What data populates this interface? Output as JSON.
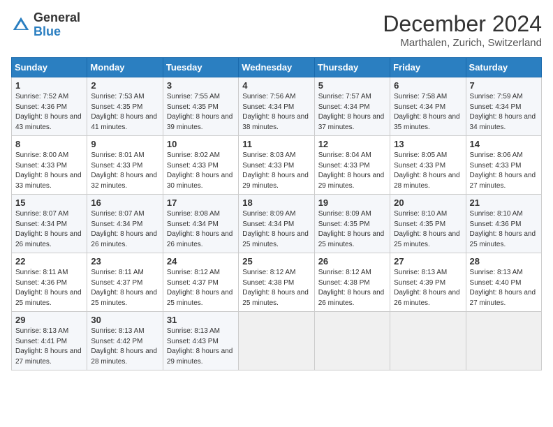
{
  "logo": {
    "general": "General",
    "blue": "Blue"
  },
  "title": "December 2024",
  "location": "Marthalen, Zurich, Switzerland",
  "headers": [
    "Sunday",
    "Monday",
    "Tuesday",
    "Wednesday",
    "Thursday",
    "Friday",
    "Saturday"
  ],
  "weeks": [
    [
      {
        "day": "1",
        "sunrise": "Sunrise: 7:52 AM",
        "sunset": "Sunset: 4:36 PM",
        "daylight": "Daylight: 8 hours and 43 minutes."
      },
      {
        "day": "2",
        "sunrise": "Sunrise: 7:53 AM",
        "sunset": "Sunset: 4:35 PM",
        "daylight": "Daylight: 8 hours and 41 minutes."
      },
      {
        "day": "3",
        "sunrise": "Sunrise: 7:55 AM",
        "sunset": "Sunset: 4:35 PM",
        "daylight": "Daylight: 8 hours and 39 minutes."
      },
      {
        "day": "4",
        "sunrise": "Sunrise: 7:56 AM",
        "sunset": "Sunset: 4:34 PM",
        "daylight": "Daylight: 8 hours and 38 minutes."
      },
      {
        "day": "5",
        "sunrise": "Sunrise: 7:57 AM",
        "sunset": "Sunset: 4:34 PM",
        "daylight": "Daylight: 8 hours and 37 minutes."
      },
      {
        "day": "6",
        "sunrise": "Sunrise: 7:58 AM",
        "sunset": "Sunset: 4:34 PM",
        "daylight": "Daylight: 8 hours and 35 minutes."
      },
      {
        "day": "7",
        "sunrise": "Sunrise: 7:59 AM",
        "sunset": "Sunset: 4:34 PM",
        "daylight": "Daylight: 8 hours and 34 minutes."
      }
    ],
    [
      {
        "day": "8",
        "sunrise": "Sunrise: 8:00 AM",
        "sunset": "Sunset: 4:33 PM",
        "daylight": "Daylight: 8 hours and 33 minutes."
      },
      {
        "day": "9",
        "sunrise": "Sunrise: 8:01 AM",
        "sunset": "Sunset: 4:33 PM",
        "daylight": "Daylight: 8 hours and 32 minutes."
      },
      {
        "day": "10",
        "sunrise": "Sunrise: 8:02 AM",
        "sunset": "Sunset: 4:33 PM",
        "daylight": "Daylight: 8 hours and 30 minutes."
      },
      {
        "day": "11",
        "sunrise": "Sunrise: 8:03 AM",
        "sunset": "Sunset: 4:33 PM",
        "daylight": "Daylight: 8 hours and 29 minutes."
      },
      {
        "day": "12",
        "sunrise": "Sunrise: 8:04 AM",
        "sunset": "Sunset: 4:33 PM",
        "daylight": "Daylight: 8 hours and 29 minutes."
      },
      {
        "day": "13",
        "sunrise": "Sunrise: 8:05 AM",
        "sunset": "Sunset: 4:33 PM",
        "daylight": "Daylight: 8 hours and 28 minutes."
      },
      {
        "day": "14",
        "sunrise": "Sunrise: 8:06 AM",
        "sunset": "Sunset: 4:33 PM",
        "daylight": "Daylight: 8 hours and 27 minutes."
      }
    ],
    [
      {
        "day": "15",
        "sunrise": "Sunrise: 8:07 AM",
        "sunset": "Sunset: 4:34 PM",
        "daylight": "Daylight: 8 hours and 26 minutes."
      },
      {
        "day": "16",
        "sunrise": "Sunrise: 8:07 AM",
        "sunset": "Sunset: 4:34 PM",
        "daylight": "Daylight: 8 hours and 26 minutes."
      },
      {
        "day": "17",
        "sunrise": "Sunrise: 8:08 AM",
        "sunset": "Sunset: 4:34 PM",
        "daylight": "Daylight: 8 hours and 26 minutes."
      },
      {
        "day": "18",
        "sunrise": "Sunrise: 8:09 AM",
        "sunset": "Sunset: 4:34 PM",
        "daylight": "Daylight: 8 hours and 25 minutes."
      },
      {
        "day": "19",
        "sunrise": "Sunrise: 8:09 AM",
        "sunset": "Sunset: 4:35 PM",
        "daylight": "Daylight: 8 hours and 25 minutes."
      },
      {
        "day": "20",
        "sunrise": "Sunrise: 8:10 AM",
        "sunset": "Sunset: 4:35 PM",
        "daylight": "Daylight: 8 hours and 25 minutes."
      },
      {
        "day": "21",
        "sunrise": "Sunrise: 8:10 AM",
        "sunset": "Sunset: 4:36 PM",
        "daylight": "Daylight: 8 hours and 25 minutes."
      }
    ],
    [
      {
        "day": "22",
        "sunrise": "Sunrise: 8:11 AM",
        "sunset": "Sunset: 4:36 PM",
        "daylight": "Daylight: 8 hours and 25 minutes."
      },
      {
        "day": "23",
        "sunrise": "Sunrise: 8:11 AM",
        "sunset": "Sunset: 4:37 PM",
        "daylight": "Daylight: 8 hours and 25 minutes."
      },
      {
        "day": "24",
        "sunrise": "Sunrise: 8:12 AM",
        "sunset": "Sunset: 4:37 PM",
        "daylight": "Daylight: 8 hours and 25 minutes."
      },
      {
        "day": "25",
        "sunrise": "Sunrise: 8:12 AM",
        "sunset": "Sunset: 4:38 PM",
        "daylight": "Daylight: 8 hours and 25 minutes."
      },
      {
        "day": "26",
        "sunrise": "Sunrise: 8:12 AM",
        "sunset": "Sunset: 4:38 PM",
        "daylight": "Daylight: 8 hours and 26 minutes."
      },
      {
        "day": "27",
        "sunrise": "Sunrise: 8:13 AM",
        "sunset": "Sunset: 4:39 PM",
        "daylight": "Daylight: 8 hours and 26 minutes."
      },
      {
        "day": "28",
        "sunrise": "Sunrise: 8:13 AM",
        "sunset": "Sunset: 4:40 PM",
        "daylight": "Daylight: 8 hours and 27 minutes."
      }
    ],
    [
      {
        "day": "29",
        "sunrise": "Sunrise: 8:13 AM",
        "sunset": "Sunset: 4:41 PM",
        "daylight": "Daylight: 8 hours and 27 minutes."
      },
      {
        "day": "30",
        "sunrise": "Sunrise: 8:13 AM",
        "sunset": "Sunset: 4:42 PM",
        "daylight": "Daylight: 8 hours and 28 minutes."
      },
      {
        "day": "31",
        "sunrise": "Sunrise: 8:13 AM",
        "sunset": "Sunset: 4:43 PM",
        "daylight": "Daylight: 8 hours and 29 minutes."
      },
      null,
      null,
      null,
      null
    ]
  ]
}
